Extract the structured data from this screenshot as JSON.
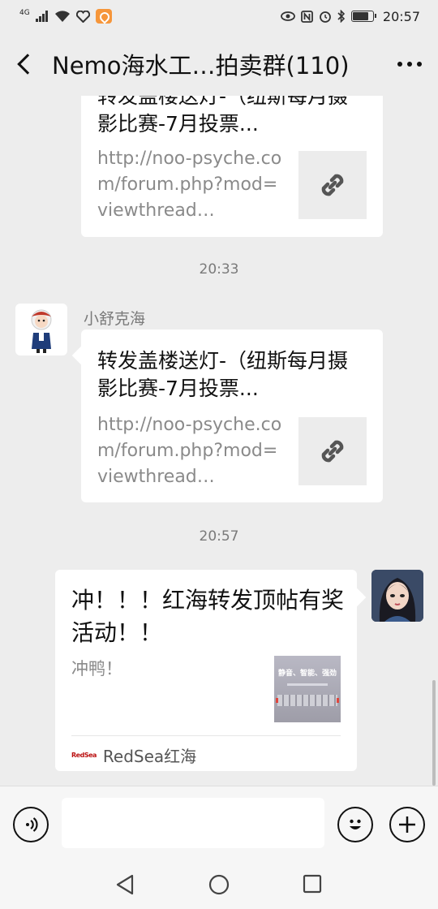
{
  "status_bar": {
    "network": "4G",
    "time": "20:57",
    "battery_level": 0.75,
    "left_icons": [
      "signal-icon",
      "wifi-icon",
      "heart-app-icon",
      "orange-app-icon"
    ],
    "right_icons": [
      "eye-icon",
      "nfc-icon",
      "alarm-icon",
      "bluetooth-icon",
      "battery-icon"
    ]
  },
  "header": {
    "title": "Nemo海水工…拍卖群(110)"
  },
  "messages": {
    "partial_card": {
      "title": "转发盖楼送灯-（纽斯每月摄影比赛-7月投票...",
      "url": "http://noo-psyche.com/forum.php?mod=viewthread…"
    },
    "time1": "20:33",
    "sender_name": "小舒克海",
    "card": {
      "title": "转发盖楼送灯-（纽斯每月摄影比赛-7月投票...",
      "url": "http://noo-psyche.com/forum.php?mod=viewthread…"
    },
    "time2": "20:57",
    "share": {
      "title": "冲！！！红海转发顶帖有奖活动！！",
      "desc": "冲鸭！",
      "thumb_text": "静音、智能、强劲",
      "source_logo": "RedSea",
      "source": "RedSea红海"
    }
  },
  "input": {
    "placeholder": ""
  },
  "colors": {
    "background": "#ededed",
    "card": "#ffffff",
    "secondary_text": "#8a8a8a"
  }
}
